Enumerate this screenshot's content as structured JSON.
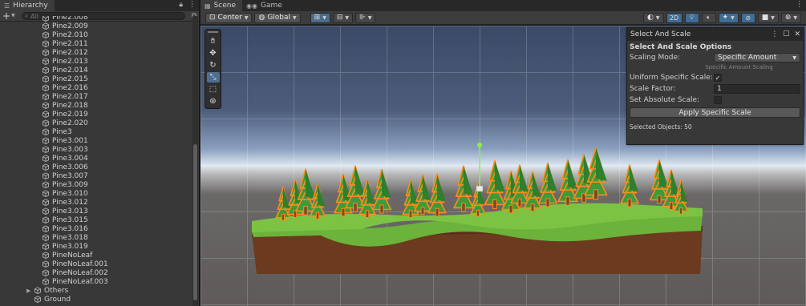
{
  "hierarchy": {
    "tab_label": "Hierarchy",
    "add_label": "+",
    "search_placeholder": "All",
    "items": [
      "Pine2.008",
      "Pine2.009",
      "Pine2.010",
      "Pine2.011",
      "Pine2.012",
      "Pine2.013",
      "Pine2.014",
      "Pine2.015",
      "Pine2.016",
      "Pine2.017",
      "Pine2.018",
      "Pine2.019",
      "Pine2.020",
      "Pine3",
      "Pine3.001",
      "Pine3.003",
      "Pine3.004",
      "Pine3.006",
      "Pine3.007",
      "Pine3.009",
      "Pine3.010",
      "Pine3.012",
      "Pine3.013",
      "Pine3.015",
      "Pine3.016",
      "Pine3.018",
      "Pine3.019",
      "PineNoLeaf",
      "PineNoLeaf.001",
      "PineNoLeaf.002",
      "PineNoLeaf.003"
    ],
    "others_label": "Others",
    "ground_label": "Ground"
  },
  "tabs": {
    "scene": "Scene",
    "game": "Game"
  },
  "scene_toolbar": {
    "pivot": "Center",
    "space": "Global",
    "mode_2d": "2D"
  },
  "panel": {
    "window_title": "Select And Scale",
    "heading": "Select And Scale Options",
    "scaling_mode_label": "Scaling Mode:",
    "scaling_mode_value": "Specific Amount",
    "section_label": "Specific Amount Scaling",
    "uniform_label": "Uniform Specific Scale:",
    "uniform_checked": "✓",
    "factor_label": "Scale Factor:",
    "factor_value": "1",
    "absolute_label": "Set Absolute Scale:",
    "apply_label": "Apply Specific Scale",
    "selected_objects": "Selected Objects: 50"
  },
  "icons": {
    "hierarchy_tab": "list-icon",
    "lock": "lock-icon",
    "menu": "kebab-menu-icon",
    "scene_tab": "grid-icon",
    "game_tab": "gamepad-icon"
  },
  "colors": {
    "accent": "#3f6d96",
    "selection_outline": "#ff8c1a",
    "tree_green": "#3e9a3a",
    "ground_brown": "#6b3a1f",
    "grass": "#6bb33a"
  }
}
